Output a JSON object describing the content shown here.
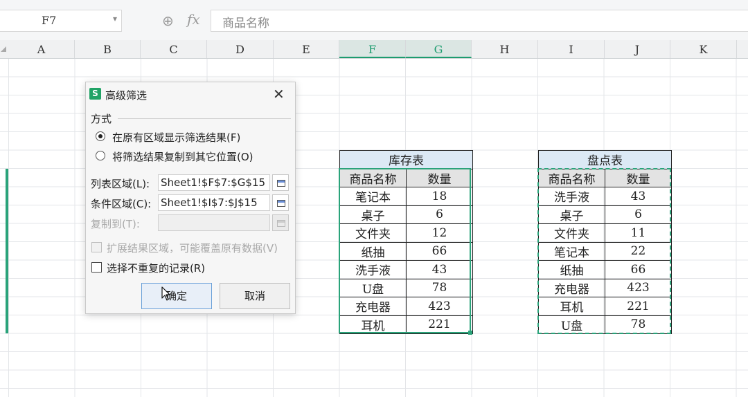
{
  "formula_bar": {
    "cell_ref": "F7",
    "dropdown_glyph": "▾",
    "zoom_glyph": "⊕",
    "fx_label": "fx",
    "content": "商品名称"
  },
  "columns": [
    "A",
    "B",
    "C",
    "D",
    "E",
    "F",
    "G",
    "H",
    "I",
    "J",
    "K"
  ],
  "selected_columns": [
    "F",
    "G"
  ],
  "inventory_table": {
    "caption": "库存表",
    "headers": [
      "商品名称",
      "数量"
    ],
    "rows": [
      [
        "笔记本",
        "18"
      ],
      [
        "桌子",
        "6"
      ],
      [
        "文件夹",
        "12"
      ],
      [
        "纸抽",
        "66"
      ],
      [
        "洗手液",
        "43"
      ],
      [
        "U盘",
        "78"
      ],
      [
        "充电器",
        "423"
      ],
      [
        "耳机",
        "221"
      ]
    ]
  },
  "count_table": {
    "caption": "盘点表",
    "headers": [
      "商品名称",
      "数量"
    ],
    "rows": [
      [
        "洗手液",
        "43"
      ],
      [
        "桌子",
        "6"
      ],
      [
        "文件夹",
        "11"
      ],
      [
        "笔记本",
        "22"
      ],
      [
        "纸抽",
        "66"
      ],
      [
        "充电器",
        "423"
      ],
      [
        "耳机",
        "221"
      ],
      [
        "U盘",
        "78"
      ]
    ]
  },
  "dialog": {
    "title": "高级筛选",
    "logo": "S",
    "close_glyph": "✕",
    "mode_group": "方式",
    "radio_inplace": "在原有区域显示筛选结果(F)",
    "radio_copy": "将筛选结果复制到其它位置(O)",
    "list_range_label": "列表区域(L):",
    "list_range_value": "Sheet1!$F$7:$G$15",
    "criteria_range_label": "条件区域(C):",
    "criteria_range_value": "Sheet1!$I$7:$J$15",
    "copy_to_label": "复制到(T):",
    "copy_to_value": "",
    "extend_label": "扩展结果区域，可能覆盖原有数据(V)",
    "unique_label": "选择不重复的记录(R)",
    "ok_label": "确定",
    "cancel_label": "取消",
    "selected_mode": "inplace",
    "unique_checked": false
  },
  "colors": {
    "accent_green": "#2aa37a",
    "caption_blue": "#dce9f5",
    "header_gray": "#e3e3e3"
  }
}
